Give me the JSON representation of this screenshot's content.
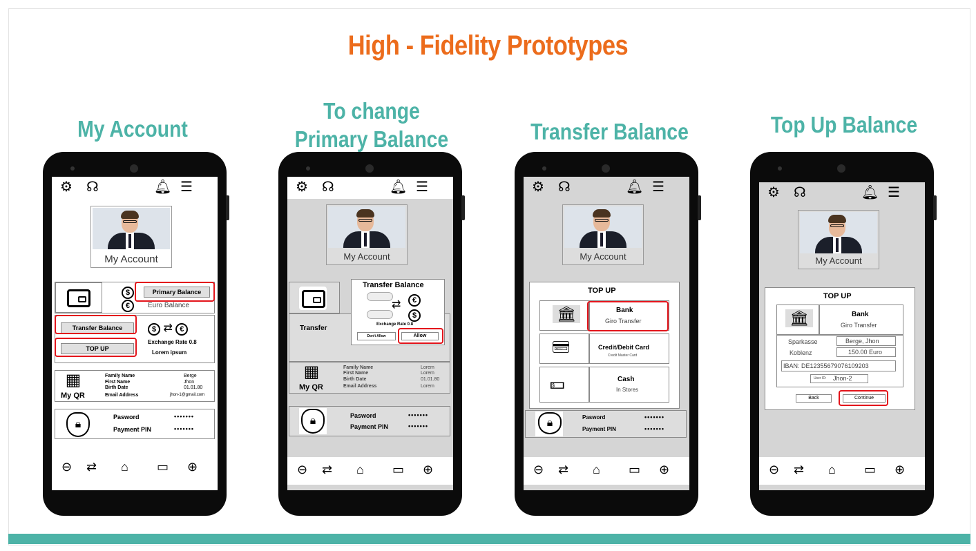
{
  "title": "High - Fidelity Prototypes",
  "captions": {
    "my_account": "My Account",
    "change_primary_line1": "To change",
    "change_primary_line2": "Primary Balance",
    "transfer": "Transfer Balance",
    "topup": "Top Up Balance"
  },
  "common": {
    "photo_label": "My Account",
    "icons": [
      "gear-icon",
      "headset-icon",
      "bell-icon",
      "menu-icon"
    ],
    "nav_icons": [
      "back-icon",
      "transfer-icon",
      "home-icon",
      "wallet-icon",
      "forward-icon"
    ],
    "password_label": "Pasword",
    "password_value": "•••••••",
    "pin_label": "Payment PIN",
    "pin_value": "•••••••",
    "qr_label": "My QR",
    "family_name_label": "Family Name",
    "first_name_label": "First  Name",
    "birth_date_label": "Birth Date",
    "email_label": "Email Address"
  },
  "screen1": {
    "primary_balance": "Primary Balance",
    "euro_balance": "Euro Balance",
    "transfer_balance": "Transfer Balance",
    "top_up": "TOP UP",
    "exchange_rate": "Exchange Rate 0.8",
    "lorem": "Lorem ipsum",
    "family_name": "Berge",
    "first_name": "Jhon",
    "birth_date": "01.01.80",
    "email": "jhon-1@gmail.com"
  },
  "screen2": {
    "dialog_title": "Transfer Balance",
    "exchange_rate": "Exchange Rate 0.8",
    "dont_allow": "Don't Allow",
    "allow": "Allow",
    "transfer_label": "Transfer",
    "family_name": "Lorem",
    "first_name": "Lorem",
    "birth_date": "01.01.80",
    "email": "Lorem"
  },
  "screen3": {
    "title": "TOP UP",
    "bank_title": "Bank",
    "bank_sub": "Giro Transfer",
    "card_title": "Credit/Debit Card",
    "card_sub": "Credit Master Card",
    "cash_title": "Cash",
    "cash_sub": "In Stores"
  },
  "screen4": {
    "title": "TOP UP",
    "bank_title": "Bank",
    "bank_sub": "Giro Transfer",
    "bank_name": "Sparkasse",
    "city": "Koblenz",
    "account_name": "Berge, Jhon",
    "amount": "150.00 Euro",
    "iban": "IBAN: DE12355679076109203",
    "user_id_label": "User ID:",
    "user_id": "Jhon-2",
    "back": "Back",
    "continue": "Continue"
  },
  "colors": {
    "title": "#ec6c1c",
    "caption": "#4db3a7",
    "highlight": "#e3141b"
  }
}
